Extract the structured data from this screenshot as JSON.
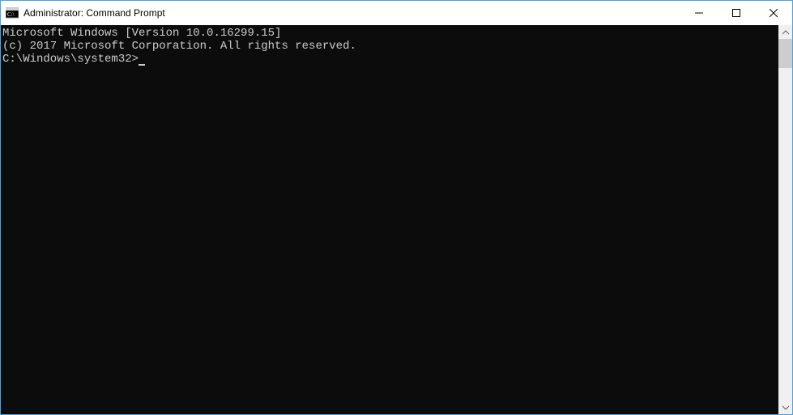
{
  "window": {
    "title": "Administrator: Command Prompt"
  },
  "terminal": {
    "line1": "Microsoft Windows [Version 10.0.16299.15]",
    "line2": "(c) 2017 Microsoft Corporation. All rights reserved.",
    "blank": "",
    "prompt": "C:\\Windows\\system32>"
  }
}
